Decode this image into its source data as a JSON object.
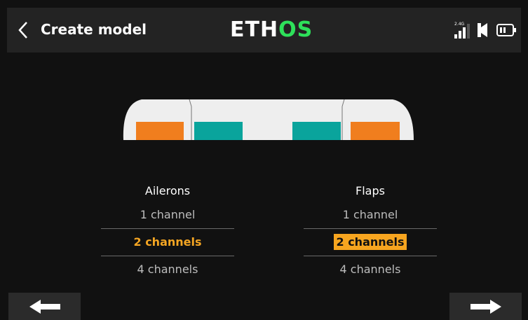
{
  "header": {
    "title": "Create model",
    "logo": {
      "part1": "ETH",
      "part2": "OS"
    },
    "status": {
      "radio_band": "2.4G"
    }
  },
  "colors": {
    "background": "#111111",
    "header": "#232323",
    "accent_orange": "#f7a51f",
    "aileron_surface": "#f07e1e",
    "flap_surface": "#0aa49c",
    "logo_green": "#2ee05a"
  },
  "wing_diagram": {
    "surfaces": [
      "aileron",
      "flap",
      "flap",
      "aileron"
    ]
  },
  "ailerons": {
    "title": "Ailerons",
    "options": [
      "1 channel",
      "2 channels",
      "4 channels"
    ],
    "selected": "2 channels"
  },
  "flaps": {
    "title": "Flaps",
    "options": [
      "1 channel",
      "2 channels",
      "4 channels"
    ],
    "selected": "2 channels"
  },
  "icons": {
    "back": "chevron-left-icon",
    "signal": "signal-bars-icon",
    "volume": "speaker-icon",
    "battery": "battery-icon",
    "prev": "arrow-left-icon",
    "next": "arrow-right-icon"
  }
}
